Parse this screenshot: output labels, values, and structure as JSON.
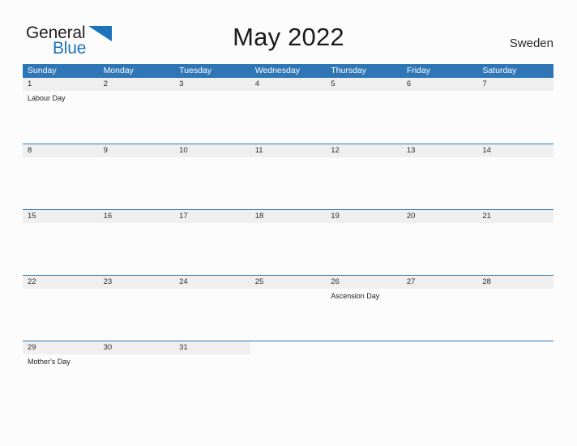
{
  "brand": {
    "name_part1": "General",
    "name_part2": "Blue",
    "flag_icon": "blue-flag-triangle-icon",
    "color_primary": "#1c73ba",
    "color_text": "#231f20"
  },
  "header": {
    "title": "May 2022",
    "country": "Sweden"
  },
  "theme": {
    "header_blue": "#2f76b6",
    "row_gray": "#efefef",
    "page_background": "#fcfcfc",
    "text_dark": "#232323"
  },
  "calendar": {
    "month": "May",
    "year": "2022",
    "weekday_headers": [
      "Sunday",
      "Monday",
      "Tuesday",
      "Wednesday",
      "Thursday",
      "Friday",
      "Saturday"
    ],
    "weeks": [
      {
        "days": [
          {
            "date": "1",
            "events": [
              "Labour Day"
            ]
          },
          {
            "date": "2",
            "events": []
          },
          {
            "date": "3",
            "events": []
          },
          {
            "date": "4",
            "events": []
          },
          {
            "date": "5",
            "events": []
          },
          {
            "date": "6",
            "events": []
          },
          {
            "date": "7",
            "events": []
          }
        ]
      },
      {
        "days": [
          {
            "date": "8",
            "events": []
          },
          {
            "date": "9",
            "events": []
          },
          {
            "date": "10",
            "events": []
          },
          {
            "date": "11",
            "events": []
          },
          {
            "date": "12",
            "events": []
          },
          {
            "date": "13",
            "events": []
          },
          {
            "date": "14",
            "events": []
          }
        ]
      },
      {
        "days": [
          {
            "date": "15",
            "events": []
          },
          {
            "date": "16",
            "events": []
          },
          {
            "date": "17",
            "events": []
          },
          {
            "date": "18",
            "events": []
          },
          {
            "date": "19",
            "events": []
          },
          {
            "date": "20",
            "events": []
          },
          {
            "date": "21",
            "events": []
          }
        ]
      },
      {
        "days": [
          {
            "date": "22",
            "events": []
          },
          {
            "date": "23",
            "events": []
          },
          {
            "date": "24",
            "events": []
          },
          {
            "date": "25",
            "events": []
          },
          {
            "date": "26",
            "events": [
              "Ascension Day"
            ]
          },
          {
            "date": "27",
            "events": []
          },
          {
            "date": "28",
            "events": []
          }
        ]
      },
      {
        "days": [
          {
            "date": "29",
            "events": [
              "Mother's Day"
            ]
          },
          {
            "date": "30",
            "events": []
          },
          {
            "date": "31",
            "events": []
          },
          {
            "date": "",
            "events": []
          },
          {
            "date": "",
            "events": []
          },
          {
            "date": "",
            "events": []
          },
          {
            "date": "",
            "events": []
          }
        ]
      }
    ]
  }
}
